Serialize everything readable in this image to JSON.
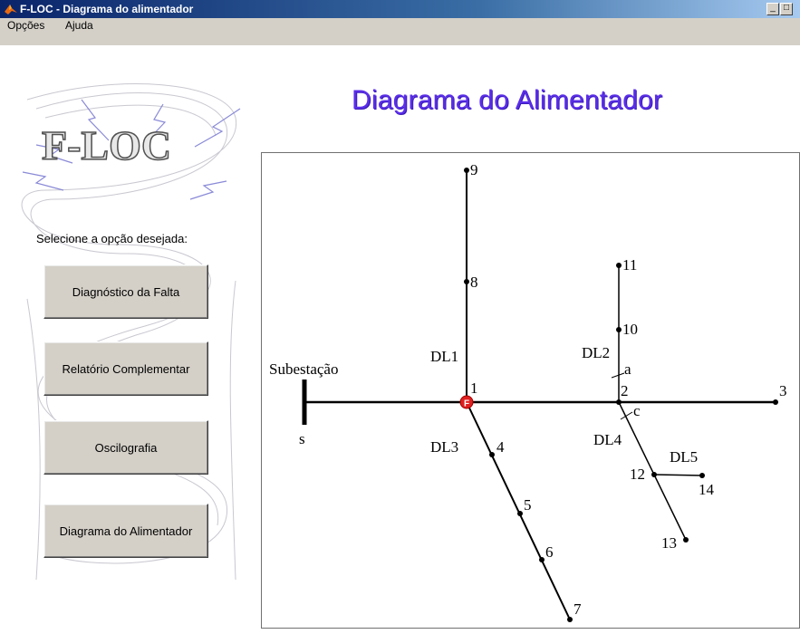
{
  "window": {
    "title": "F-LOC - Diagrama do alimentador",
    "min_label": "_",
    "max_label": "□"
  },
  "menu": {
    "items": [
      {
        "label": "Opções"
      },
      {
        "label": "Ajuda"
      }
    ]
  },
  "logo": {
    "text": "F-LOC"
  },
  "sidebar": {
    "prompt": "Selecione a opção desejada:",
    "buttons": [
      {
        "label": "Diagnóstico da Falta"
      },
      {
        "label": "Relatório Complementar"
      },
      {
        "label": "Oscilografia"
      },
      {
        "label": "Diagrama do Alimentador"
      }
    ]
  },
  "main": {
    "title": "Diagrama do Alimentador"
  },
  "diagram": {
    "substation_label": "Subestação",
    "substation_node": "s",
    "fault_marker": "F",
    "segment_labels": {
      "dl1": "DL1",
      "dl2": "DL2",
      "dl3": "DL3",
      "dl4": "DL4",
      "dl5": "DL5"
    },
    "point_labels": {
      "a": "a",
      "c": "c"
    },
    "nodes": {
      "n1": "1",
      "n2": "2",
      "n3": "3",
      "n4": "4",
      "n5": "5",
      "n6": "6",
      "n7": "7",
      "n8": "8",
      "n9": "9",
      "n10": "10",
      "n11": "11",
      "n12": "12",
      "n13": "13",
      "n14": "14"
    }
  }
}
